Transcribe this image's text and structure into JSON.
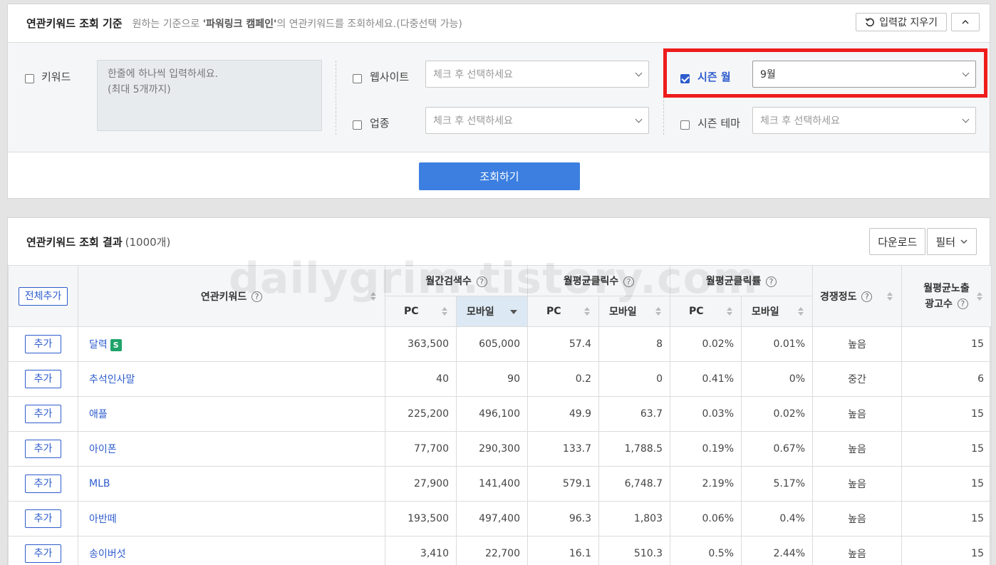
{
  "criteria": {
    "title": "연관키워드 조회 기준",
    "desc_prefix": "원하는 기준으로 ",
    "desc_bold": "'파워링크 캠페인'",
    "desc_suffix": "의 연관키워드를 조회하세요.(다중선택 가능)",
    "clear_label": "입력값 지우기",
    "keyword_label": "키워드",
    "keyword_placeholder_line1": "한줄에 하나씩 입력하세요.",
    "keyword_placeholder_line2": "(최대 5개까지)",
    "website_label": "웹사이트",
    "website_placeholder": "체크 후 선택하세요",
    "industry_label": "업종",
    "industry_placeholder": "체크 후 선택하세요",
    "season_month_label": "시즌 월",
    "season_month_value": "9월",
    "season_theme_label": "시즌 테마",
    "season_theme_placeholder": "체크 후 선택하세요",
    "search_label": "조회하기"
  },
  "results": {
    "title": "연관키워드 조회 결과",
    "count": "(1000개)",
    "download_label": "다운로드",
    "filter_label": "필터",
    "watermark": "dailygrim.tistory.com",
    "headers": {
      "add_all": "전체추가",
      "keyword": "연관키워드",
      "monthly_search": "월간검색수",
      "monthly_clicks": "월평균클릭수",
      "monthly_ctr": "월평균클릭률",
      "competition": "경쟁정도",
      "ads_line1": "월평균노출",
      "ads_line2": "광고수",
      "pc": "PC",
      "mobile": "모바일"
    },
    "add_label": "추가",
    "rows": [
      {
        "keyword": "달력",
        "badge": "S",
        "pc": "363,500",
        "mobile": "605,000",
        "click_pc": "57.4",
        "click_mobile": "8",
        "ctr_pc": "0.02%",
        "ctr_mobile": "0.01%",
        "competition": "높음",
        "ads": "15"
      },
      {
        "keyword": "추석인사말",
        "badge": "",
        "pc": "40",
        "mobile": "90",
        "click_pc": "0.2",
        "click_mobile": "0",
        "ctr_pc": "0.41%",
        "ctr_mobile": "0%",
        "competition": "중간",
        "ads": "6"
      },
      {
        "keyword": "애플",
        "badge": "",
        "pc": "225,200",
        "mobile": "496,100",
        "click_pc": "49.9",
        "click_mobile": "63.7",
        "ctr_pc": "0.03%",
        "ctr_mobile": "0.02%",
        "competition": "높음",
        "ads": "15"
      },
      {
        "keyword": "아이폰",
        "badge": "",
        "pc": "77,700",
        "mobile": "290,300",
        "click_pc": "133.7",
        "click_mobile": "1,788.5",
        "ctr_pc": "0.19%",
        "ctr_mobile": "0.67%",
        "competition": "높음",
        "ads": "15"
      },
      {
        "keyword": "MLB",
        "badge": "",
        "pc": "27,900",
        "mobile": "141,400",
        "click_pc": "579.1",
        "click_mobile": "6,748.7",
        "ctr_pc": "2.19%",
        "ctr_mobile": "5.17%",
        "competition": "높음",
        "ads": "15"
      },
      {
        "keyword": "아반떼",
        "badge": "",
        "pc": "193,500",
        "mobile": "497,400",
        "click_pc": "96.3",
        "click_mobile": "1,803",
        "ctr_pc": "0.06%",
        "ctr_mobile": "0.4%",
        "competition": "높음",
        "ads": "15"
      },
      {
        "keyword": "송이버섯",
        "badge": "",
        "pc": "3,410",
        "mobile": "22,700",
        "click_pc": "16.1",
        "click_mobile": "510.3",
        "ctr_pc": "0.5%",
        "ctr_mobile": "2.44%",
        "competition": "높음",
        "ads": "15"
      }
    ]
  }
}
